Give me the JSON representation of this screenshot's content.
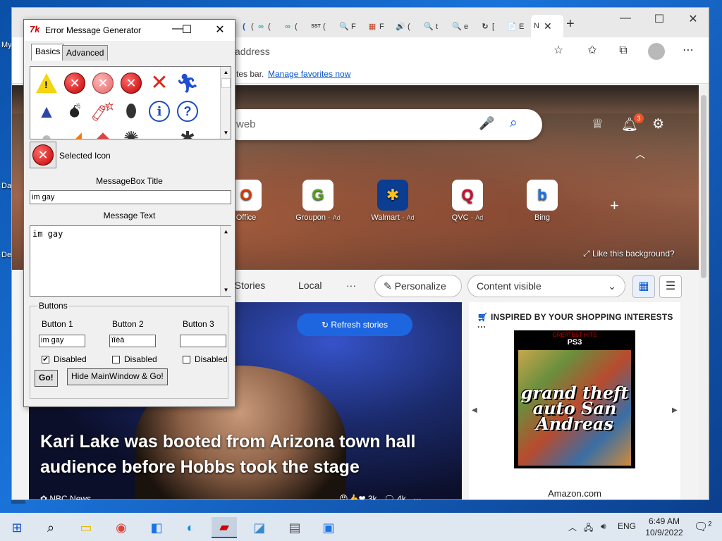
{
  "desktop": {
    "label1": "My",
    "label2": "Da",
    "label3": "De"
  },
  "browser": {
    "tabs": [
      {
        "icon": "(",
        "text": "("
      },
      {
        "icon": "∞",
        "text": "("
      },
      {
        "icon": "∞",
        "text": "("
      },
      {
        "icon": "SST",
        "text": "("
      },
      {
        "icon": "🔍",
        "text": "F"
      },
      {
        "icon": "▦",
        "text": "F"
      },
      {
        "icon": "🔊",
        "text": "("
      },
      {
        "icon": "🔍",
        "text": "t"
      },
      {
        "icon": "🔍",
        "text": "e"
      },
      {
        "icon": "↻",
        "text": "["
      },
      {
        "icon": "📄",
        "text": "E"
      }
    ],
    "active_tab": {
      "text": "N"
    },
    "address_placeholder": "address",
    "favbar_text": "tes bar.",
    "favbar_link": "Manage favorites now",
    "search_placeholder": "web",
    "bell_count": "3",
    "quicklinks": [
      {
        "name": "Office",
        "ad": "",
        "glyph": "O",
        "color": "#d83b01"
      },
      {
        "name": "Groupon",
        "ad": "Ad",
        "glyph": "G",
        "color": "#53a318"
      },
      {
        "name": "Walmart",
        "ad": "Ad",
        "glyph": "✱",
        "color": "#ffc220"
      },
      {
        "name": "QVC",
        "ad": "Ad",
        "glyph": "Q",
        "color": "#c8102e"
      },
      {
        "name": "Bing",
        "ad": "",
        "glyph": "b",
        "color": "#1a73e8"
      }
    ],
    "like_background": "Like this background?",
    "nav": {
      "top_stories": "p Stories",
      "local": "Local",
      "more": "···",
      "personalize": "Personalize",
      "content_visible": "Content visible"
    },
    "refresh_stories": "Refresh stories",
    "headline": "Kari Lake was booted from Arizona town hall audience before Hobbs took the stage",
    "source": "NBC News",
    "reactions": "3k",
    "comments": "4k",
    "shop_header": "INSPIRED BY YOUR SHOPPING INTERESTS",
    "shop_more": "···",
    "product_top": "GREATEST HITS",
    "product_platform": "PS3",
    "product_title": "grand theft auto San Andreas",
    "shop_store": "Amazon.com"
  },
  "dialog": {
    "logo": "7k",
    "title": "Error Message Generator",
    "tabs": {
      "basics": "Basics",
      "advanced": "Advanced"
    },
    "selected_icon_label": "Selected Icon",
    "msgbox_title_label": "MessageBox Title",
    "msgbox_title_value": "im gay",
    "message_text_label": "Message Text",
    "message_text_value": "im gay",
    "buttons_group": "Buttons",
    "button1_label": "Button 1",
    "button2_label": "Button 2",
    "button3_label": "Button 3",
    "button1_value": "im gay",
    "button2_value": "ïîèà",
    "button3_value": "",
    "disabled1": "Disabled",
    "disabled2": "Disabled",
    "disabled3": "Disabled",
    "disabled1_checked": true,
    "go_button": "Go!",
    "hide_go_button": "Hide MainWindow & Go!"
  },
  "taskbar": {
    "language": "ENG",
    "time": "6:49 AM",
    "date": "10/9/2022",
    "notif_count": "2"
  }
}
